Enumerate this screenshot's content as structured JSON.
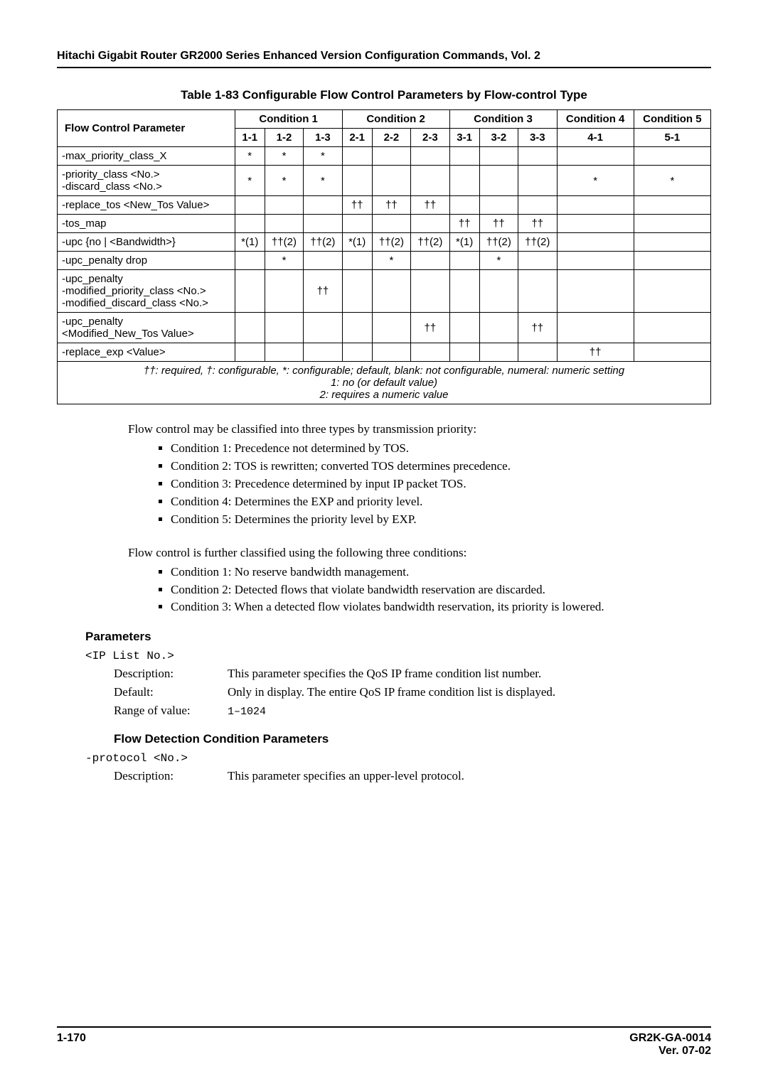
{
  "running_head": "Hitachi Gigabit Router GR2000 Series Enhanced Version Configuration Commands, Vol. 2",
  "table_caption": "Table 1-83  Configurable Flow Control Parameters by Flow-control Type",
  "headers": {
    "param": "Flow Control Parameter",
    "c1": "Condition 1",
    "c2": "Condition 2",
    "c3": "Condition 3",
    "c4": "Condition 4",
    "c5": "Condition 5",
    "s11": "1-1",
    "s12": "1-2",
    "s13": "1-3",
    "s21": "2-1",
    "s22": "2-2",
    "s23": "2-3",
    "s31": "3-1",
    "s32": "3-2",
    "s33": "3-3",
    "s41": "4-1",
    "s51": "5-1"
  },
  "rows": [
    {
      "p": "-max_priority_class_X",
      "c": [
        "*",
        "*",
        "*",
        "",
        "",
        "",
        "",
        "",
        "",
        "",
        ""
      ]
    },
    {
      "p": "-priority_class <No.>\n-discard_class <No.>",
      "c": [
        "*",
        "*",
        "*",
        "",
        "",
        "",
        "",
        "",
        "",
        "*",
        "*"
      ]
    },
    {
      "p": "-replace_tos <New_Tos Value>",
      "c": [
        "",
        "",
        "",
        "††",
        "††",
        "††",
        "",
        "",
        "",
        "",
        ""
      ]
    },
    {
      "p": "-tos_map",
      "c": [
        "",
        "",
        "",
        "",
        "",
        "",
        "††",
        "††",
        "††",
        "",
        ""
      ]
    },
    {
      "p": "-upc {no | <Bandwidth>}",
      "c": [
        "*(1)",
        "††(2)",
        "††(2)",
        "*(1)",
        "††(2)",
        "††(2)",
        "*(1)",
        "††(2)",
        "††(2)",
        "",
        ""
      ]
    },
    {
      "p": "-upc_penalty drop",
      "c": [
        "",
        "*",
        "",
        "",
        "*",
        "",
        "",
        "*",
        "",
        "",
        ""
      ]
    },
    {
      "p": "-upc_penalty\n-modified_priority_class <No.>\n-modified_discard_class <No.>",
      "c": [
        "",
        "",
        "††",
        "",
        "",
        "",
        "",
        "",
        "",
        "",
        ""
      ]
    },
    {
      "p": "-upc_penalty\n<Modified_New_Tos Value>",
      "c": [
        "",
        "",
        "",
        "",
        "",
        "††",
        "",
        "",
        "††",
        "",
        ""
      ]
    },
    {
      "p": "-replace_exp <Value>",
      "c": [
        "",
        "",
        "",
        "",
        "",
        "",
        "",
        "",
        "",
        "††",
        ""
      ]
    }
  ],
  "legend": "††: required, †: configurable, *: configurable; default, blank: not configurable, numeral: numeric setting\n1: no (or default value)\n2: requires a numeric value",
  "intro1": "Flow control may be classified into three types by transmission priority:",
  "intro1_items": [
    "Condition 1: Precedence not determined by TOS.",
    "Condition 2: TOS is rewritten; converted TOS determines precedence.",
    "Condition 3: Precedence determined by input IP packet TOS.",
    "Condition 4: Determines the EXP and priority level.",
    "Condition 5: Determines the priority level by EXP."
  ],
  "intro2": "Flow control is further classified using the following three conditions:",
  "intro2_items": [
    "Condition 1: No reserve bandwidth management.",
    "Condition 2: Detected flows that violate bandwidth reservation are discarded.",
    "Condition 3: When a detected flow violates bandwidth reservation, its priority is lowered."
  ],
  "sections": {
    "parameters": "Parameters",
    "flow_detection": "Flow Detection Condition Parameters"
  },
  "ip_list": {
    "name": "<IP List No.>",
    "desc_label": "Description:",
    "desc_value": "This parameter specifies the QoS IP frame condition list number.",
    "default_label": "Default:",
    "default_value": "Only in display. The entire QoS IP frame condition list is displayed.",
    "range_label": "Range of value:",
    "range_value": "1–1024"
  },
  "protocol": {
    "name": "-protocol <No.>",
    "desc_label": "Description:",
    "desc_value": "This parameter specifies an upper-level protocol."
  },
  "footer": {
    "page": "1-170",
    "doc": "GR2K-GA-0014",
    "ver": "Ver. 07-02"
  }
}
